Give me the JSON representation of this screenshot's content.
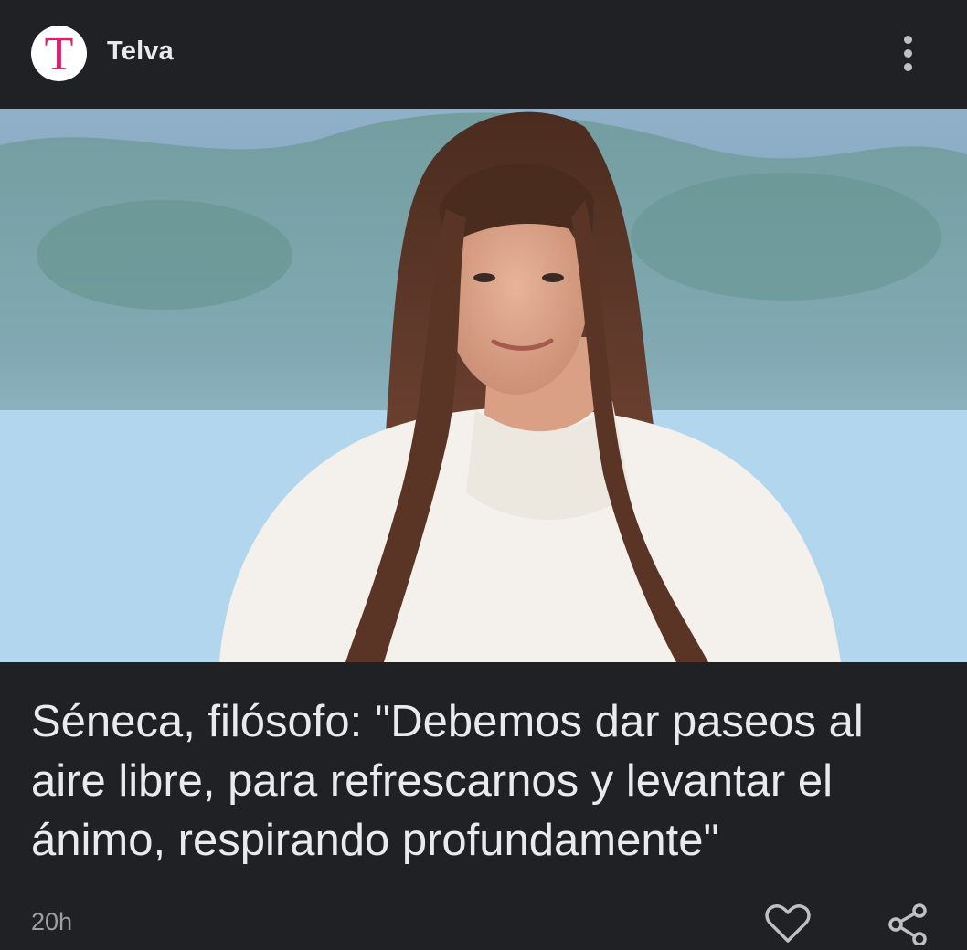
{
  "header": {
    "logo_letter": "T",
    "source_name": "Telva",
    "menu_icon": "more-vert-icon"
  },
  "article": {
    "image_icon": "article-photo",
    "headline": "Séneca, filósofo: \"Debemos dar paseos al aire libre, para refrescarnos y levantar el ánimo, respirando profundamente\"",
    "time": "20h"
  },
  "actions": {
    "like_icon": "heart-icon",
    "share_icon": "share-icon"
  },
  "colors": {
    "background": "#202124",
    "logo_accent": "#d6246e",
    "text_primary": "#e8eaed",
    "text_secondary": "#9aa0a6"
  }
}
